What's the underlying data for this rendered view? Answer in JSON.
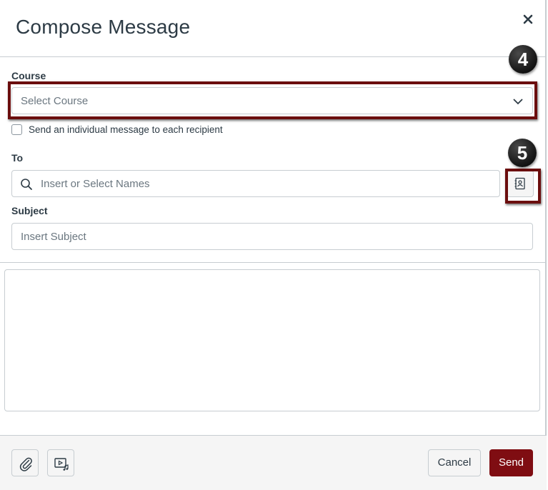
{
  "dialog": {
    "title": "Compose Message",
    "close_icon": "close-icon"
  },
  "course": {
    "label": "Course",
    "placeholder": "Select Course",
    "icon": "chevron-down-icon"
  },
  "individual_message": {
    "label": "Send an individual message to each recipient",
    "checked": false
  },
  "to": {
    "label": "To",
    "placeholder": "Insert or Select Names",
    "search_icon": "search-icon",
    "address_book_icon": "address-book-icon"
  },
  "subject": {
    "label": "Subject",
    "placeholder": "Insert Subject"
  },
  "message_body": {
    "value": ""
  },
  "footer": {
    "attach_icon": "paperclip-icon",
    "media_icon": "media-icon",
    "cancel_label": "Cancel",
    "send_label": "Send"
  },
  "callouts": [
    "4",
    "5"
  ],
  "colors": {
    "callout_border": "#6b0e0e",
    "send_button": "#7f0d12",
    "badge": "#1a1a1a"
  }
}
